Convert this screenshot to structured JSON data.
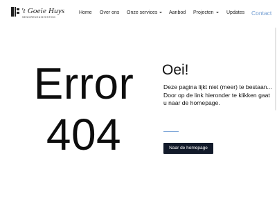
{
  "header": {
    "logo": {
      "name": "'t Goeie Huys",
      "tagline": "Seniorenhuisvesting"
    },
    "nav": [
      {
        "label": "Home",
        "dropdown": false
      },
      {
        "label": "Over ons",
        "dropdown": false
      },
      {
        "label": "Onze services",
        "dropdown": true
      },
      {
        "label": "Aanbod",
        "dropdown": false
      },
      {
        "label": "Projecten",
        "dropdown": true
      },
      {
        "label": "Updates",
        "dropdown": false
      }
    ],
    "contact_label": "Contact",
    "accent_color": "#6f9bd0"
  },
  "main": {
    "error_word": "Error",
    "error_code": "404",
    "oops": "Oei!",
    "message_line1": "Deze pagina lijkt niet (meer) te bestaan...",
    "message_line2": "Door op de link hieronder te klikken gaat u naar de homepage.",
    "button_label": "Naar de homepage",
    "button_color": "#121a2a"
  }
}
